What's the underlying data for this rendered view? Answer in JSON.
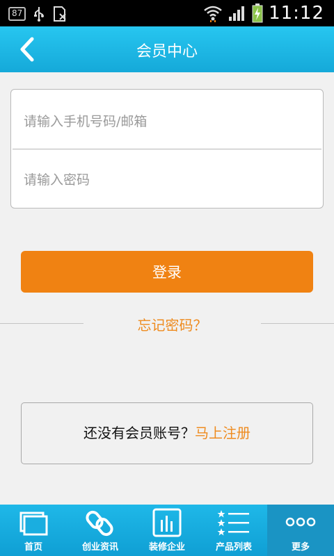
{
  "status_bar": {
    "notification_badge": "87",
    "icons": [
      "usb-icon",
      "blocked-sim-icon",
      "wifi-icon",
      "signal-icon",
      "battery-charging-icon"
    ],
    "time": "11:12"
  },
  "header": {
    "title": "会员中心",
    "back_icon": "chevron-left-icon"
  },
  "login_form": {
    "phone_placeholder": "请输入手机号码/邮箱",
    "password_placeholder": "请输入密码",
    "login_label": "登录",
    "forgot_label": "忘记密码？"
  },
  "register": {
    "prompt": "还没有会员账号？",
    "link_label": "马上注册"
  },
  "tabs": [
    {
      "label": "首页",
      "icon": "home-pages-icon",
      "active": false
    },
    {
      "label": "创业资讯",
      "icon": "chain-link-icon",
      "active": false
    },
    {
      "label": "装修企业",
      "icon": "bar-chart-icon",
      "active": false
    },
    {
      "label": "产品列表",
      "icon": "star-list-icon",
      "active": false
    },
    {
      "label": "更多",
      "icon": "more-dots-icon",
      "active": true
    }
  ],
  "colors": {
    "header_blue": "#15a9d9",
    "accent_orange": "#f08212",
    "tab_active": "#1a94c4"
  }
}
